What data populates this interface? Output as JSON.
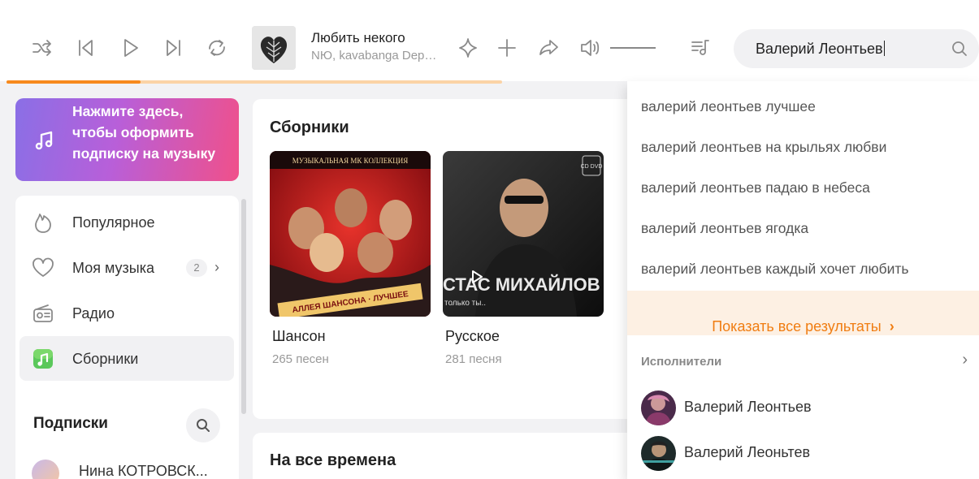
{
  "player": {
    "track_title": "Любить некого",
    "track_artist": "NЮ, kavabanga Depo kolibri",
    "progress": 0.27,
    "buffered": 1.0
  },
  "search": {
    "value": "Валерий Леонтьев"
  },
  "promo": {
    "text": "Нажмите здесь, чтобы оформить подписку на музыку"
  },
  "sidebar": {
    "items": [
      {
        "label": "Популярное",
        "icon": "fire-icon"
      },
      {
        "label": "Моя музыка",
        "icon": "heart-icon",
        "badge": "2"
      },
      {
        "label": "Радио",
        "icon": "radio-icon"
      },
      {
        "label": "Сборники",
        "icon": "collections-icon",
        "active": true
      }
    ],
    "subscriptions_title": "Подписки",
    "subscriptions": [
      {
        "name": "Нина КОТРОВСК..."
      }
    ]
  },
  "main": {
    "collections_title": "Сборники",
    "collections": [
      {
        "name": "Шансон",
        "count": "265 песен",
        "cover_text_top": "МУЗЫКАЛЬНАЯ МК КОЛЛЕКЦИЯ",
        "cover_text_bottom": "АЛЛЕЯ ШАНСОНА · ЛУЧШЕЕ"
      },
      {
        "name": "Русское",
        "count": "281 песня",
        "cover_text_top": "СТАС МИХАЙЛОВ",
        "cover_text_bottom": "только ты..",
        "cover_badge": "CD DVD"
      }
    ],
    "all_time_title": "На все времена"
  },
  "dropdown": {
    "suggestions": [
      "валерий леонтьев лучшее",
      "валерий леонтьев на крыльях любви",
      "валерий леонтьев падаю в небеса",
      "валерий леонтьев ягодка",
      "валерий леонтьев каждый хочет любить"
    ],
    "show_all": "Показать все результаты",
    "artists_title": "Исполнители",
    "artists": [
      {
        "name": "Валерий Леонтьев"
      },
      {
        "name": "Валерий Леоньтев"
      }
    ]
  },
  "colors": {
    "accent": "#f78a1e",
    "accent_light": "#fbd3a6",
    "promo_gradient_start": "#8a6fe6",
    "promo_gradient_end": "#f0508a",
    "active_nav": "#f1f1f3"
  }
}
